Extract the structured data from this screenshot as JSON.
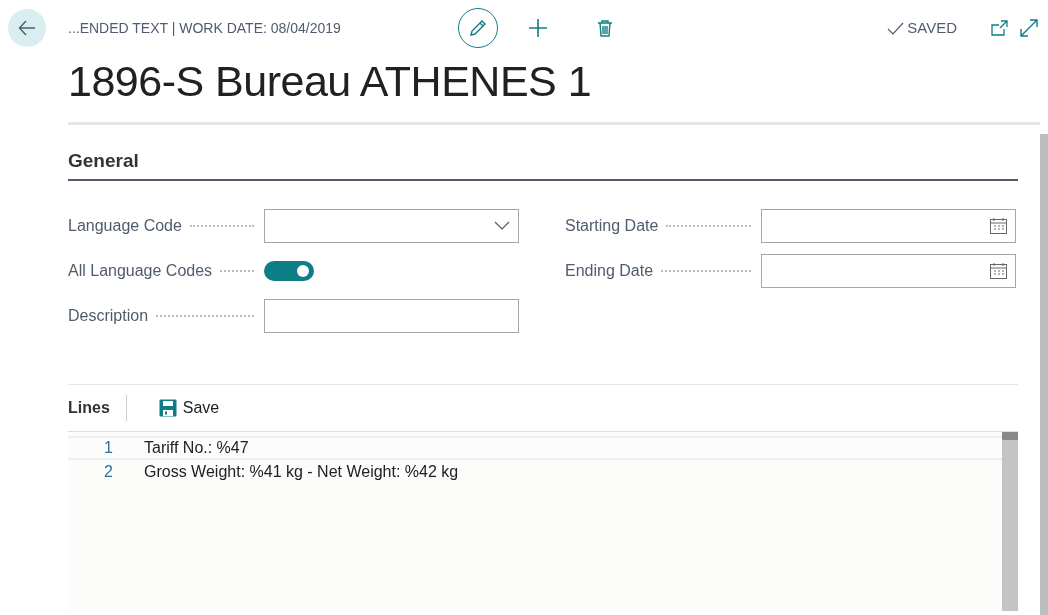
{
  "header": {
    "caption": "...ENDED TEXT | WORK DATE: 08/04/2019",
    "status": "SAVED"
  },
  "title": "1896-S Bureau ATHENES 1",
  "general": {
    "heading": "General",
    "left_fields": [
      {
        "kind": "dropdown",
        "label": "Language Code"
      },
      {
        "kind": "toggle",
        "label": "All Language Codes",
        "on": true
      },
      {
        "kind": "text",
        "label": "Description"
      }
    ],
    "right_fields": [
      {
        "kind": "date",
        "label": "Starting Date"
      },
      {
        "kind": "date",
        "label": "Ending Date"
      }
    ]
  },
  "lines": {
    "heading": "Lines",
    "save_label": "Save",
    "rows": [
      {
        "number": "1",
        "text": "Tariff No.: %47",
        "selected": true
      },
      {
        "number": "2",
        "text": "Gross Weight: %41 kg - Net Weight: %42 kg",
        "selected": false
      }
    ]
  }
}
